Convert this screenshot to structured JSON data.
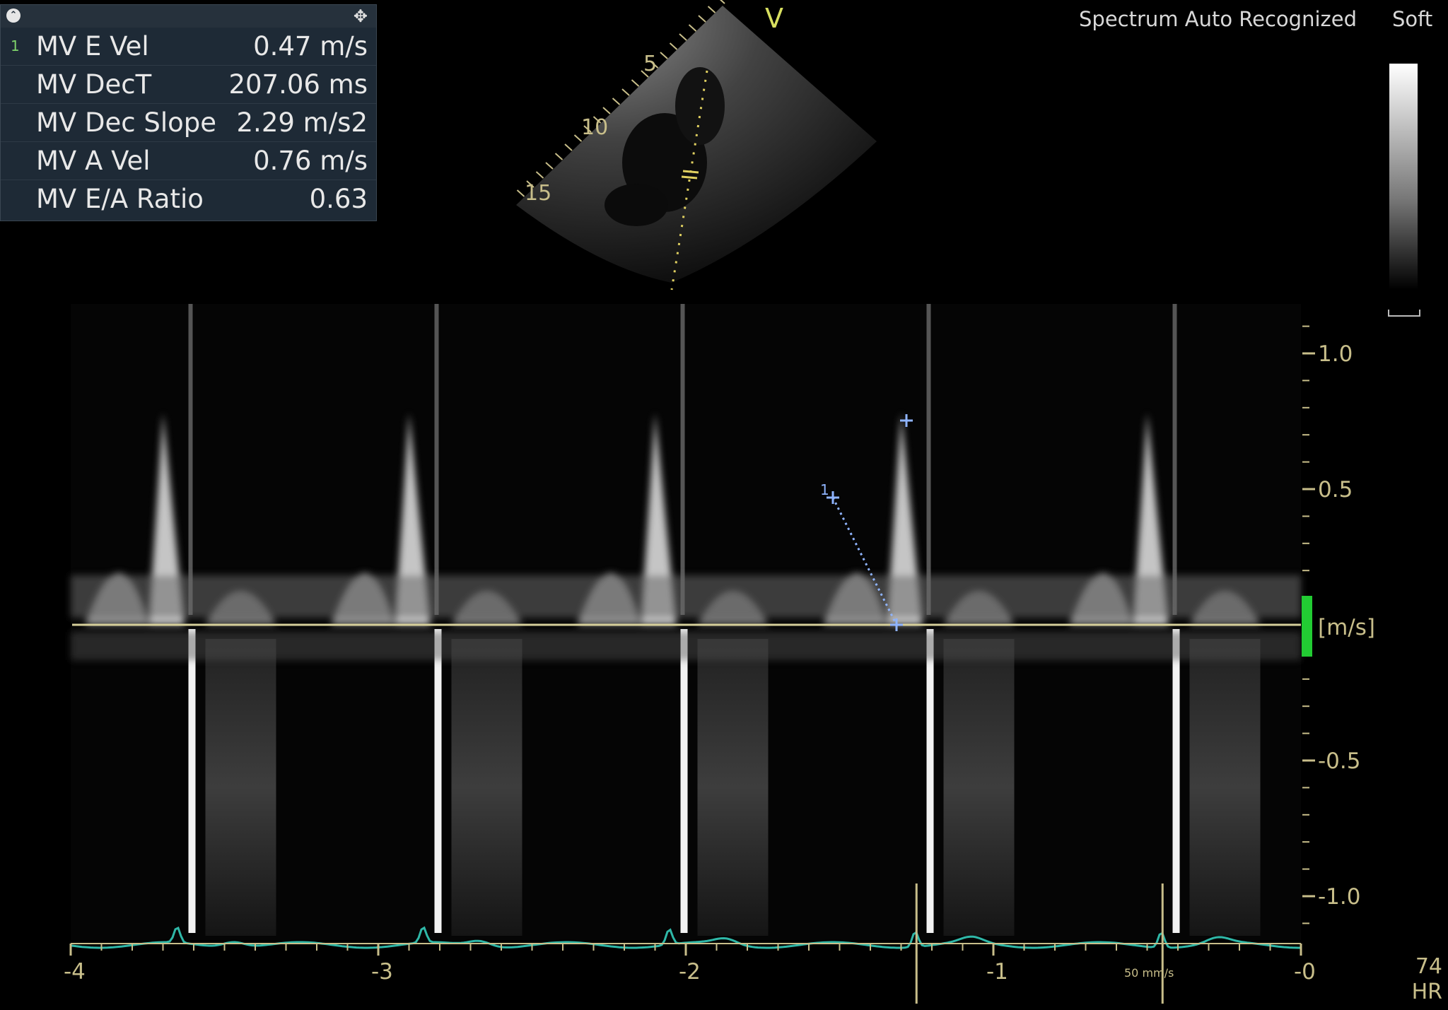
{
  "measurements": [
    {
      "index": "1",
      "label": "MV E Vel",
      "value": "0.47 m/s"
    },
    {
      "index": "",
      "label": "MV DecT",
      "value": "207.06 ms"
    },
    {
      "index": "",
      "label": "MV Dec Slope",
      "value": "2.29 m/s2"
    },
    {
      "index": "",
      "label": "MV A Vel",
      "value": "0.76 m/s"
    },
    {
      "index": "",
      "label": "MV E/A Ratio",
      "value": "0.63"
    }
  ],
  "panel": {
    "collapse_icon": "chevron-up-icon",
    "move_icon": "move-icon"
  },
  "mode_label": "V",
  "spectrum_status": "Spectrum Auto Recognized",
  "gray_map": "Soft",
  "depth_labels": [
    "5",
    "10",
    "15"
  ],
  "velocity_scale": {
    "unit": "[m/s]",
    "ticks": [
      "1.0",
      "0.5",
      "-0.5",
      "-1.0"
    ],
    "tick_values": [
      1.0,
      0.5,
      -0.5,
      -1.0
    ]
  },
  "time_axis": {
    "ticks": [
      "-4",
      "-3",
      "-2",
      "-1",
      "-0"
    ],
    "tick_values": [
      -4,
      -3,
      -2,
      -1,
      0
    ]
  },
  "sweep_speed": "50 mm/s",
  "heart_rate": {
    "value": "74",
    "label": "HR"
  },
  "colors": {
    "panel_bg": "#1e2a36",
    "axis_text": "#c8be8a",
    "ecg_trace": "#2fb8a8",
    "caliper": "#8fb4ff",
    "baseline_marker": "#22cc33",
    "mode_label": "#d8e060"
  }
}
